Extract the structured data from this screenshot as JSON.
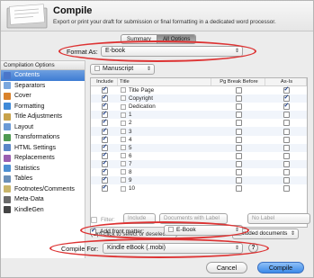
{
  "header": {
    "title": "Compile",
    "subtitle": "Export or print your draft for submission or final formatting in a dedicated word processor."
  },
  "tabs": [
    {
      "label": "Summary",
      "active": false
    },
    {
      "label": "All Options",
      "active": true
    }
  ],
  "format_as": {
    "label": "Format As:",
    "value": "E-book"
  },
  "sidebar": {
    "heading": "Compilation Options",
    "items": [
      {
        "label": "Contents",
        "icon": "contents-icon",
        "color": "#4a76c9",
        "selected": true
      },
      {
        "label": "Separators",
        "icon": "separators-icon",
        "color": "#7aa7de"
      },
      {
        "label": "Cover",
        "icon": "cover-icon",
        "color": "#d9822b"
      },
      {
        "label": "Formatting",
        "icon": "formatting-icon",
        "color": "#3f8ad8"
      },
      {
        "label": "Title Adjustments",
        "icon": "title-adjustments-icon",
        "color": "#c8a24a"
      },
      {
        "label": "Layout",
        "icon": "layout-icon",
        "color": "#6b9ad6"
      },
      {
        "label": "Transformations",
        "icon": "transformations-icon",
        "color": "#4f9a52"
      },
      {
        "label": "HTML Settings",
        "icon": "html-settings-icon",
        "color": "#5b86c8"
      },
      {
        "label": "Replacements",
        "icon": "replacements-icon",
        "color": "#9a5fb0"
      },
      {
        "label": "Statistics",
        "icon": "statistics-icon",
        "color": "#4c8fd2"
      },
      {
        "label": "Tables",
        "icon": "tables-icon",
        "color": "#6a8fb8"
      },
      {
        "label": "Footnotes/Comments",
        "icon": "footnotes-icon",
        "color": "#c9b56a"
      },
      {
        "label": "Meta-Data",
        "icon": "meta-data-icon",
        "color": "#6a6a6a"
      },
      {
        "label": "KindleGen",
        "icon": "kindlegen-icon",
        "color": "#444444"
      }
    ]
  },
  "manuscript": {
    "value": "Manuscript"
  },
  "table": {
    "headers": [
      "Include",
      "Title",
      "Pg Break Before",
      "As-Is"
    ],
    "rows": [
      {
        "title": "Title Page",
        "include": true,
        "pgbreak": false,
        "asis": true
      },
      {
        "title": "Copyright",
        "include": true,
        "pgbreak": false,
        "asis": true
      },
      {
        "title": "Dedication",
        "include": true,
        "pgbreak": false,
        "asis": true
      },
      {
        "title": "1",
        "include": true,
        "pgbreak": false,
        "asis": false
      },
      {
        "title": "2",
        "include": true,
        "pgbreak": false,
        "asis": false
      },
      {
        "title": "3",
        "include": true,
        "pgbreak": false,
        "asis": false
      },
      {
        "title": "4",
        "include": true,
        "pgbreak": false,
        "asis": false
      },
      {
        "title": "5",
        "include": true,
        "pgbreak": false,
        "asis": false
      },
      {
        "title": "6",
        "include": true,
        "pgbreak": false,
        "asis": false
      },
      {
        "title": "7",
        "include": true,
        "pgbreak": false,
        "asis": false
      },
      {
        "title": "8",
        "include": true,
        "pgbreak": false,
        "asis": false
      },
      {
        "title": "9",
        "include": true,
        "pgbreak": false,
        "asis": false
      },
      {
        "title": "10",
        "include": true,
        "pgbreak": false,
        "asis": false
      }
    ]
  },
  "hint": "(Opt-click to select or deselect all.)",
  "compile_opt": {
    "label": "Compile:",
    "value": "Included documents"
  },
  "filter": {
    "label": "Filter:",
    "include": "Include",
    "documents": "Documents with Label",
    "nolabel": "No Label"
  },
  "front_matter": {
    "label": "Add front matter:",
    "checked": true,
    "value": "E-Book"
  },
  "compile_for": {
    "label": "Compile For:",
    "value": "Kindle eBook (.mobi)"
  },
  "buttons": {
    "help": "?",
    "cancel": "Cancel",
    "compile": "Compile"
  }
}
